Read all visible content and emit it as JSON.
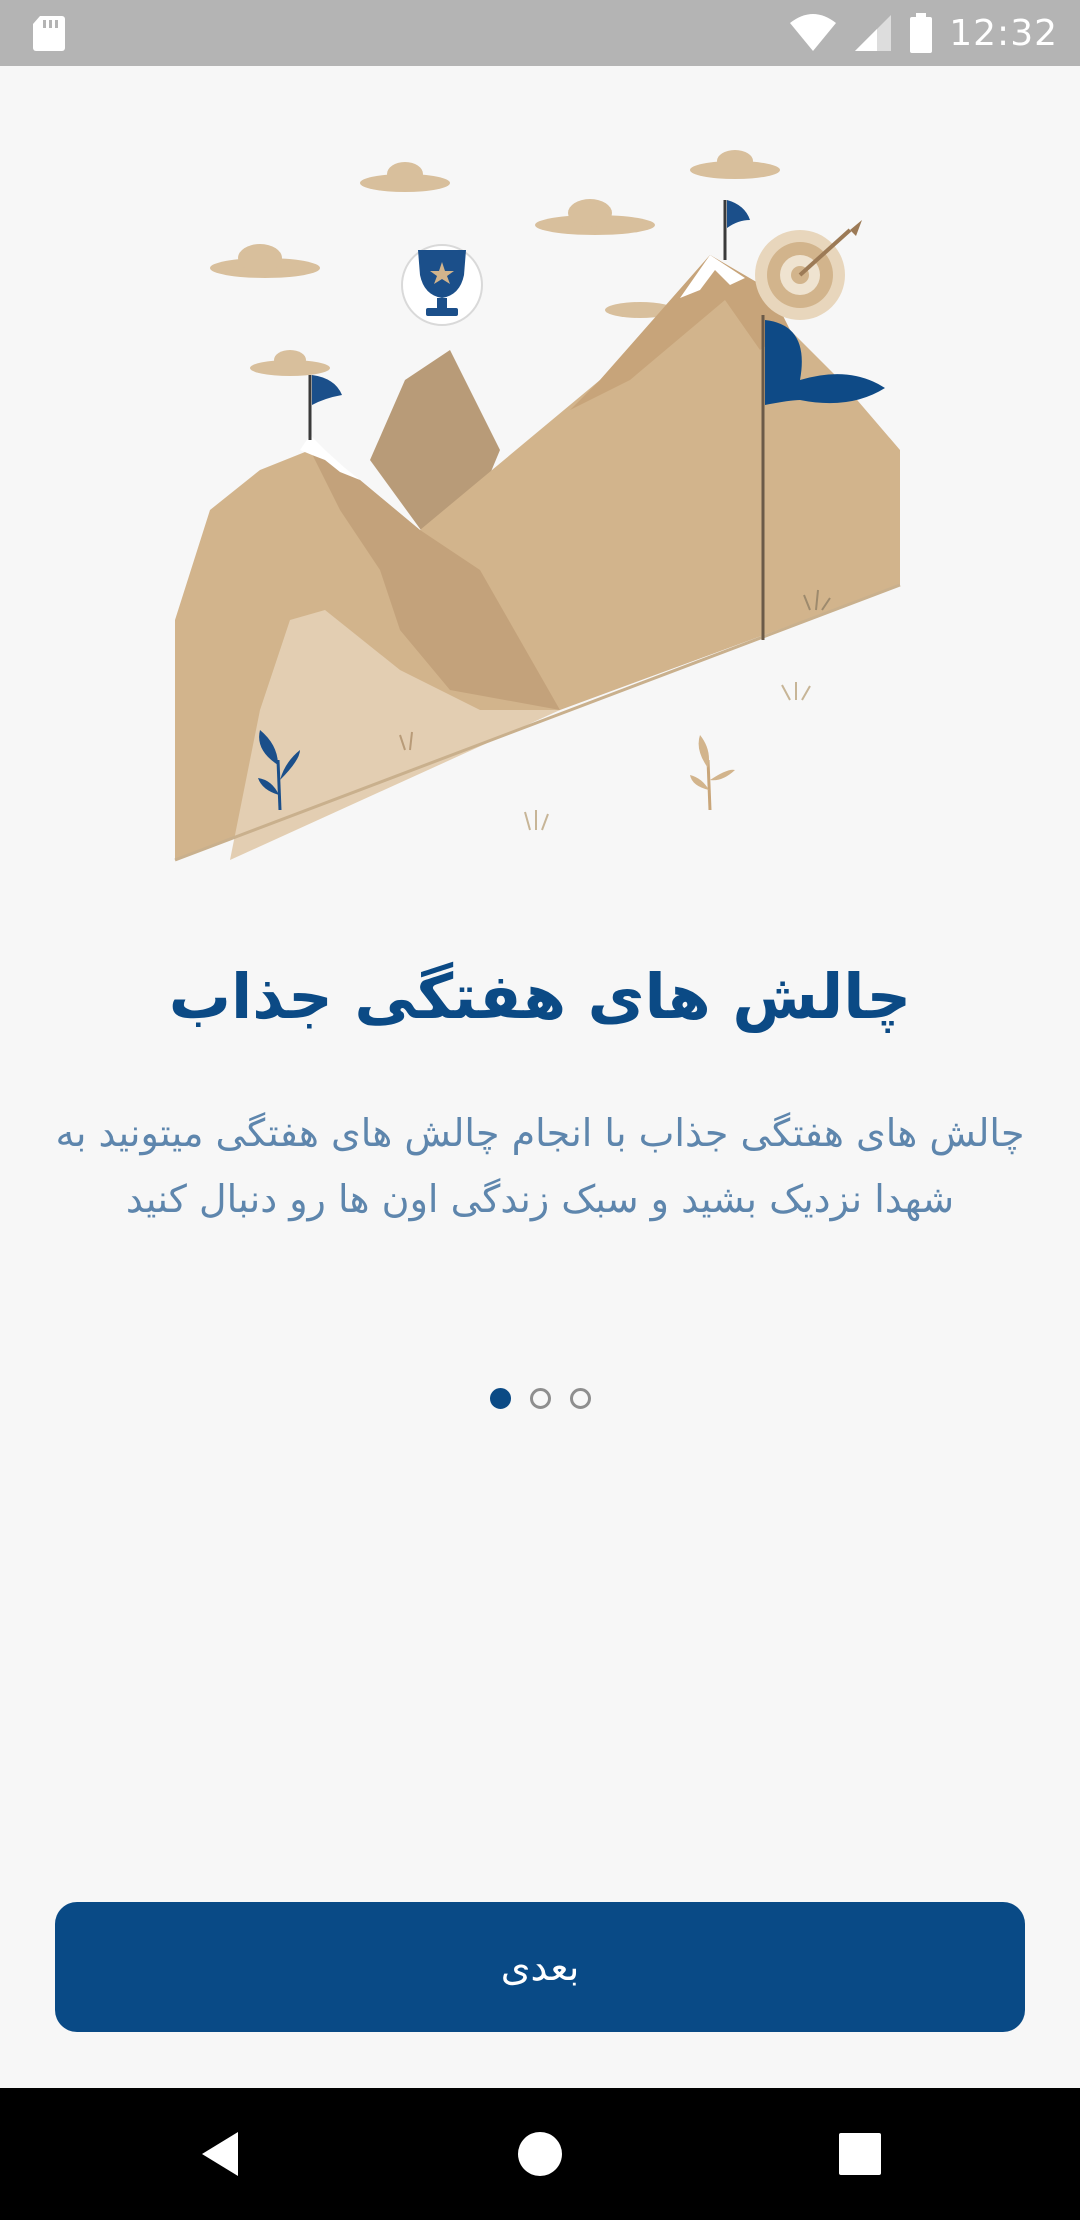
{
  "status_bar": {
    "time": "12:32",
    "icons": [
      "sd-card-icon",
      "wifi-icon",
      "signal-icon",
      "battery-icon"
    ]
  },
  "onboarding": {
    "illustration": "mountains-flags-trophy-target-illustration",
    "title": "چالش های هفتگی جذاب",
    "description": "چالش های هفتگی جذاب با انجام چالش های هفتگی میتونید به شهدا نزدیک بشید و سبک زندگی اون ها رو دنبال کنید",
    "page_count": 3,
    "current_page": 1,
    "next_label": "بعدی"
  },
  "nav_bar": {
    "icons": [
      "back-icon",
      "home-icon",
      "recents-icon"
    ]
  },
  "colors": {
    "primary": "#094a86",
    "title": "#0b4a85",
    "description": "#5e86ad",
    "background": "#f7f7f7",
    "status_bar": "#b4b4b4",
    "mountain": "#d2b48c"
  }
}
